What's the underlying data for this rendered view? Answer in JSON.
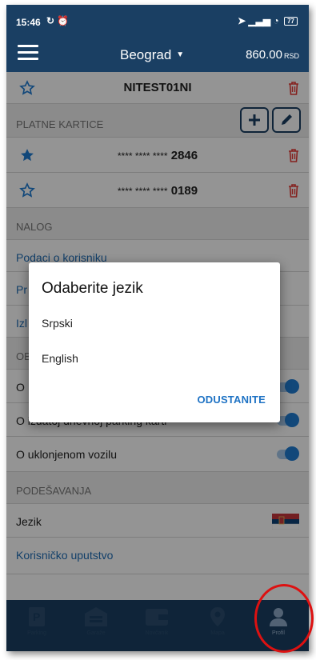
{
  "status_bar": {
    "time": "15:46",
    "left_icons": [
      "no-sync-icon",
      "alarm-icon"
    ],
    "right_icons": [
      "location-icon",
      "signal-icon",
      "wifi-icon"
    ],
    "battery": "77"
  },
  "header": {
    "menu_icon": "hamburger-menu-icon",
    "city": "Beograd",
    "balance": "860.00",
    "currency": "RSD"
  },
  "plates": [
    {
      "number": "NITEST01NI",
      "favorite": false
    }
  ],
  "cards_section": {
    "title": "PLATNE KARTICE",
    "add_icon": "plus-icon",
    "edit_icon": "pencil-icon",
    "cards": [
      {
        "mask": "**** **** ****",
        "last4": "2846",
        "favorite": true
      },
      {
        "mask": "**** **** ****",
        "last4": "0189",
        "favorite": false
      }
    ]
  },
  "account_section": {
    "title": "NALOG",
    "items": [
      "Podaci o korisniku",
      "Pr",
      "Izl"
    ]
  },
  "notifications_section": {
    "title": "OB",
    "items": [
      {
        "label": "O",
        "enabled": true
      },
      {
        "label": "O izdatoj dnevnoj parking karti",
        "enabled": true
      },
      {
        "label": "O uklonjenom vozilu",
        "enabled": true
      }
    ]
  },
  "settings_section": {
    "title": "PODEŠAVANJA",
    "language_label": "Jezik",
    "language_flag": "serbia-flag",
    "manual_label": "Korisničko uputstvo"
  },
  "bottom_nav": {
    "items": [
      {
        "icon": "parking-icon",
        "label": "Parking"
      },
      {
        "icon": "garage-icon",
        "label": "Garaže"
      },
      {
        "icon": "wallet-icon",
        "label": "Novčanik"
      },
      {
        "icon": "map-pin-icon",
        "label": "Mapa"
      },
      {
        "icon": "user-icon",
        "label": "Profil"
      }
    ],
    "active_index": 4
  },
  "dialog": {
    "title": "Odaberite jezik",
    "options": [
      "Srpski",
      "English"
    ],
    "cancel_label": "ODUSTANITE"
  },
  "colors": {
    "primary": "#1a3f63",
    "accent": "#1f7cd3",
    "danger": "#e53935",
    "annotation": "#dd1111"
  }
}
